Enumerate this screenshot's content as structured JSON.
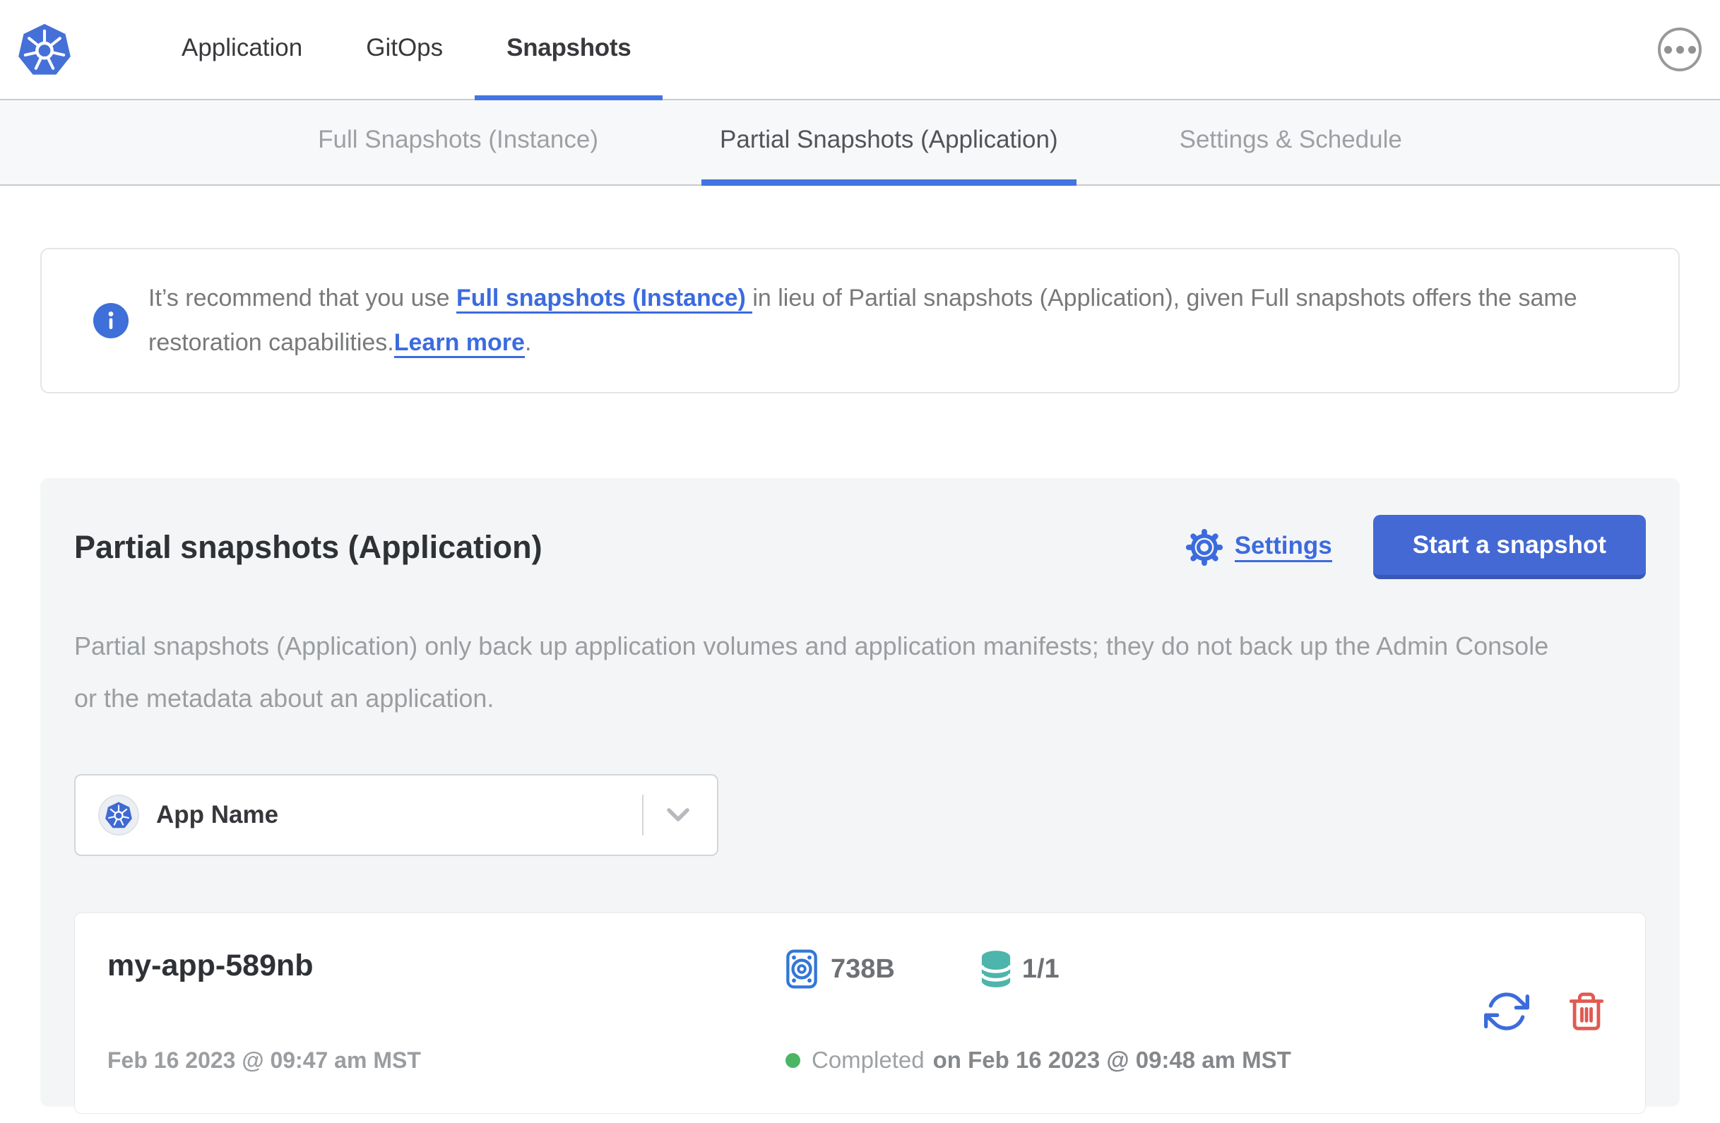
{
  "colors": {
    "accent_blue": "#4374e0",
    "button_blue": "#4469d4",
    "link_blue": "#3b6bde",
    "kubernetes_blue": "#4470d8",
    "teal": "#4db5ab",
    "danger_red": "#e05a52",
    "success_green": "#4cb564"
  },
  "header": {
    "logo_icon": "kubernetes-logo",
    "menu_icon": "ellipsis-menu",
    "nav": [
      {
        "label": "Application",
        "active": false
      },
      {
        "label": "GitOps",
        "active": false
      },
      {
        "label": "Snapshots",
        "active": true
      }
    ]
  },
  "subnav": {
    "tabs": [
      {
        "label": "Full Snapshots (Instance)",
        "active": false
      },
      {
        "label": "Partial Snapshots (Application)",
        "active": true
      },
      {
        "label": "Settings & Schedule",
        "active": false
      }
    ]
  },
  "banner": {
    "icon": "info-icon",
    "text_start": "It’s recommend that you use ",
    "link_full_snapshots": "Full snapshots (Instance) ",
    "text_middle": "in lieu of Partial snapshots (Application), given Full snapshots offers the same restoration capabilities.",
    "link_learn_more": "Learn more",
    "text_end": "."
  },
  "main": {
    "title": "Partial snapshots (Application)",
    "settings": {
      "icon": "gear-icon",
      "label": "Settings"
    },
    "start_button": "Start a snapshot",
    "description": "Partial snapshots (Application) only back up application volumes and application manifests; they do not back up the Admin Console or the metadata about an application.",
    "app_selector": {
      "icon": "kubernetes-icon",
      "value": "App Name",
      "chevron": "chevron-down-icon"
    },
    "snapshot": {
      "name": "my-app-589nb",
      "started": "Feb 16 2023 @ 09:47 am MST",
      "size_icon": "disk-icon",
      "size": "738B",
      "volumes_icon": "database-icon",
      "volumes": "1/1",
      "status": "Completed",
      "status_time": "on Feb 16 2023 @ 09:48 am MST",
      "restore_icon": "restore-icon",
      "delete_icon": "trash-icon"
    }
  }
}
